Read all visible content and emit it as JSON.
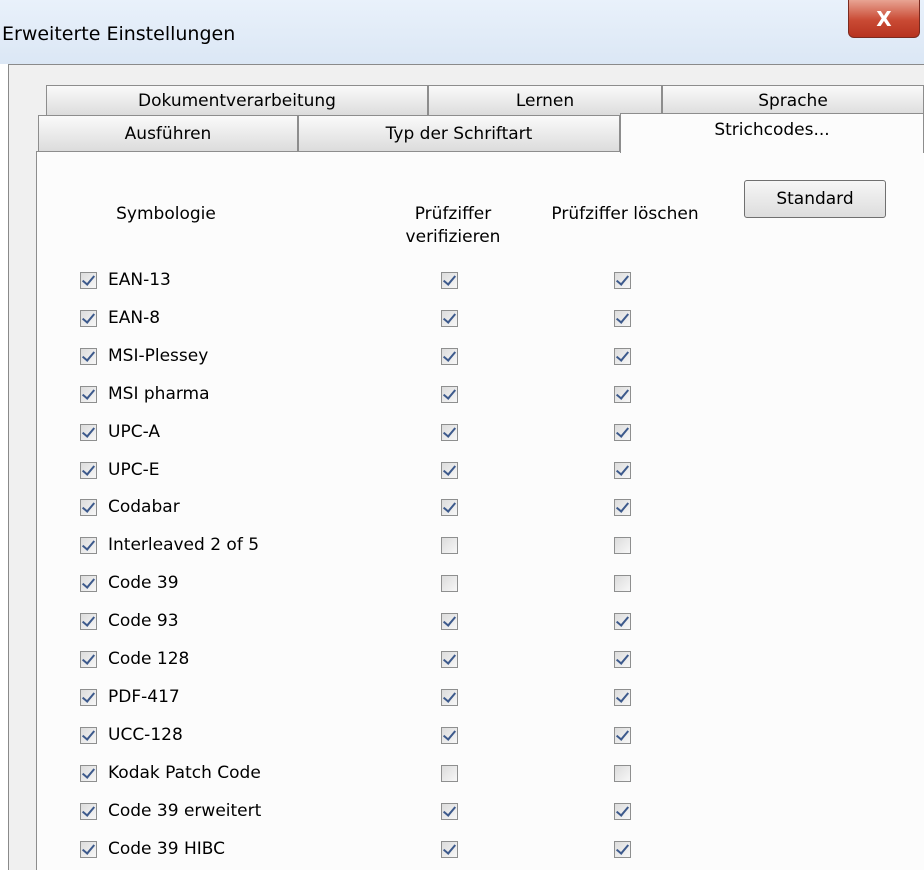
{
  "window": {
    "title": "Erweiterte Einstellungen",
    "close_label": "X"
  },
  "tabs": {
    "row1": [
      "Dokumentverarbeitung",
      "Lernen",
      "Sprache"
    ],
    "row2": [
      "Ausführen",
      "Typ der Schriftart",
      "Strichcodes..."
    ],
    "active": "Strichcodes..."
  },
  "header": {
    "symbology": "Symbologie",
    "verify_line1": "Prüfziffer",
    "verify_line2": "verifizieren",
    "delete": "Prüfziffer löschen",
    "default_button": "Standard"
  },
  "rows": [
    {
      "name": "EAN-13",
      "enabled": true,
      "verify": true,
      "delete": true
    },
    {
      "name": "EAN-8",
      "enabled": true,
      "verify": true,
      "delete": true
    },
    {
      "name": "MSI-Plessey",
      "enabled": true,
      "verify": true,
      "delete": true
    },
    {
      "name": "MSI pharma",
      "enabled": true,
      "verify": true,
      "delete": true
    },
    {
      "name": "UPC-A",
      "enabled": true,
      "verify": true,
      "delete": true
    },
    {
      "name": "UPC-E",
      "enabled": true,
      "verify": true,
      "delete": true
    },
    {
      "name": "Codabar",
      "enabled": true,
      "verify": true,
      "delete": true
    },
    {
      "name": "Interleaved 2 of 5",
      "enabled": true,
      "verify": false,
      "delete": false
    },
    {
      "name": "Code 39",
      "enabled": true,
      "verify": false,
      "delete": false
    },
    {
      "name": "Code 93",
      "enabled": true,
      "verify": true,
      "delete": true
    },
    {
      "name": "Code 128",
      "enabled": true,
      "verify": true,
      "delete": true
    },
    {
      "name": "PDF-417",
      "enabled": true,
      "verify": true,
      "delete": true
    },
    {
      "name": "UCC-128",
      "enabled": true,
      "verify": true,
      "delete": true
    },
    {
      "name": "Kodak Patch Code",
      "enabled": true,
      "verify": false,
      "delete": false
    },
    {
      "name": "Code 39 erweitert",
      "enabled": true,
      "verify": true,
      "delete": true
    },
    {
      "name": "Code 39 HIBC",
      "enabled": true,
      "verify": true,
      "delete": true
    }
  ]
}
